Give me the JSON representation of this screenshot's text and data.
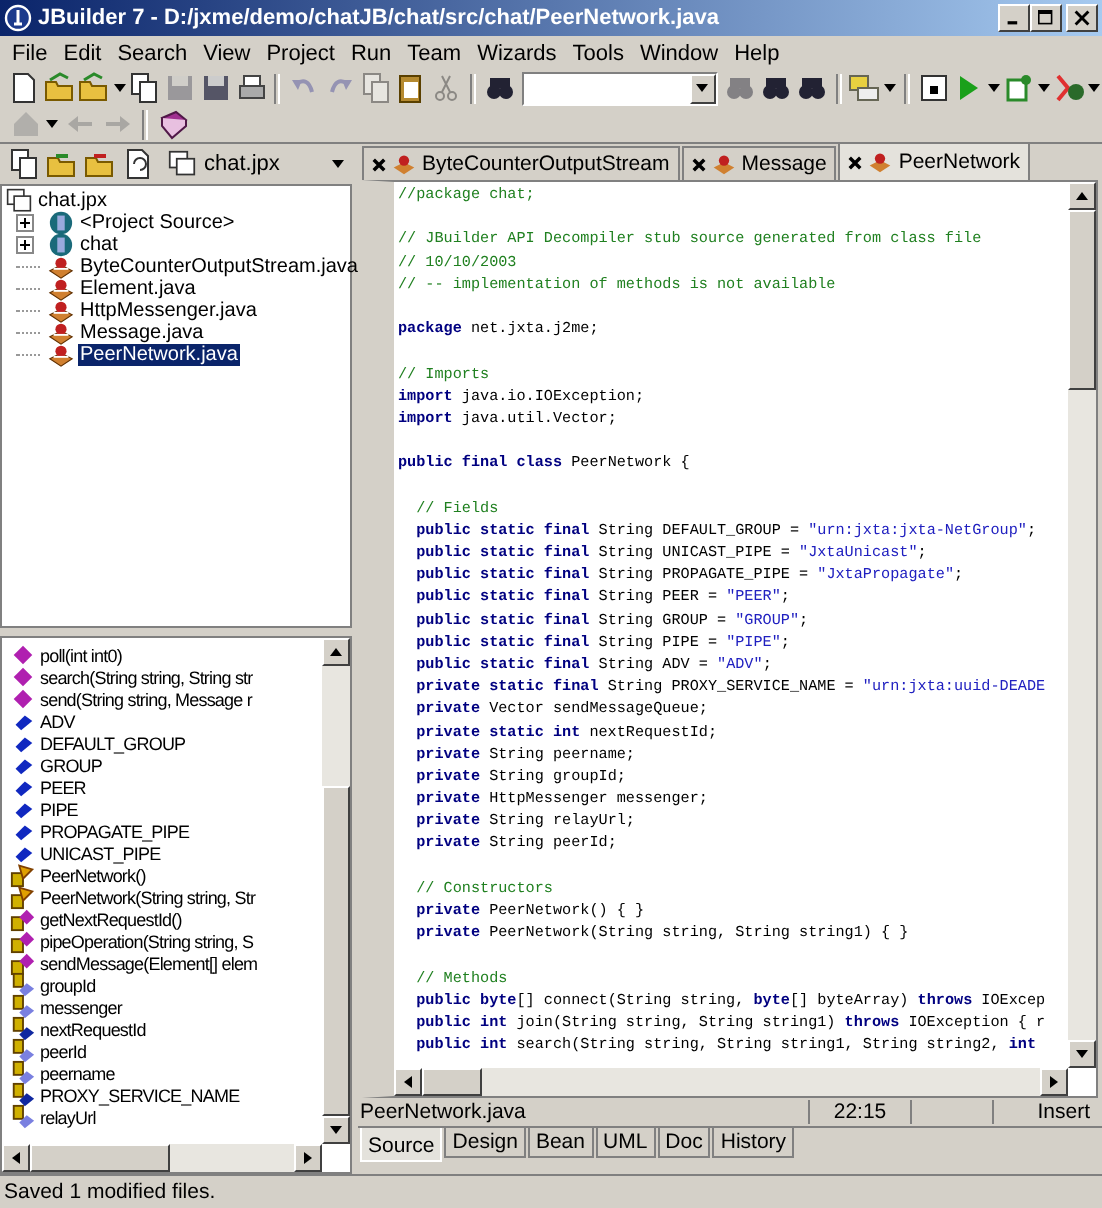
{
  "window": {
    "title": "JBuilder 7 - D:/jxme/demo/chatJB/chat/src/chat/PeerNetwork.java"
  },
  "menu": [
    "File",
    "Edit",
    "Search",
    "View",
    "Project",
    "Run",
    "Team",
    "Wizards",
    "Tools",
    "Window",
    "Help"
  ],
  "project_selector": {
    "value": "chat.jpx"
  },
  "project_tree": {
    "label": "chat.jpx",
    "children": [
      {
        "label": "<Project Source>",
        "kind": "package",
        "expanded": false,
        "selected": false
      },
      {
        "label": "chat",
        "kind": "package",
        "expanded": false,
        "selected": false
      },
      {
        "label": "ByteCounterOutputStream.java",
        "kind": "file",
        "selected": false
      },
      {
        "label": "Element.java",
        "kind": "file",
        "selected": false
      },
      {
        "label": "HttpMessenger.java",
        "kind": "file",
        "selected": false
      },
      {
        "label": "Message.java",
        "kind": "file",
        "selected": false
      },
      {
        "label": "PeerNetwork.java",
        "kind": "file",
        "selected": true
      }
    ]
  },
  "structure": [
    {
      "label": "poll(int int0)",
      "kind": "method"
    },
    {
      "label": "search(String string, String str",
      "kind": "method"
    },
    {
      "label": "send(String string, Message r",
      "kind": "method"
    },
    {
      "label": "ADV",
      "kind": "const"
    },
    {
      "label": "DEFAULT_GROUP",
      "kind": "const"
    },
    {
      "label": "GROUP",
      "kind": "const"
    },
    {
      "label": "PEER",
      "kind": "const"
    },
    {
      "label": "PIPE",
      "kind": "const"
    },
    {
      "label": "PROPAGATE_PIPE",
      "kind": "const"
    },
    {
      "label": "UNICAST_PIPE",
      "kind": "const"
    },
    {
      "label": "PeerNetwork()",
      "kind": "ctor"
    },
    {
      "label": "PeerNetwork(String string, Str",
      "kind": "ctor"
    },
    {
      "label": "getNextRequestId()",
      "kind": "private-method"
    },
    {
      "label": "pipeOperation(String string, S",
      "kind": "private-method"
    },
    {
      "label": "sendMessage(Element[] elem",
      "kind": "private-method"
    },
    {
      "label": "groupId",
      "kind": "private-field"
    },
    {
      "label": "messenger",
      "kind": "private-field"
    },
    {
      "label": "nextRequestId",
      "kind": "private-static"
    },
    {
      "label": "peerId",
      "kind": "private-field"
    },
    {
      "label": "peername",
      "kind": "private-field"
    },
    {
      "label": "PROXY_SERVICE_NAME",
      "kind": "private-static"
    },
    {
      "label": "relayUrl",
      "kind": "private-field"
    }
  ],
  "editor_tabs": [
    {
      "label": "ByteCounterOutputStream",
      "selected": false
    },
    {
      "label": "Message",
      "selected": false
    },
    {
      "label": "PeerNetwork",
      "selected": true
    }
  ],
  "code": [
    {
      "kind": "code",
      "tokens": [
        {
          "kind": "comment",
          "text": "//package chat;"
        }
      ]
    },
    {
      "kind": "blank"
    },
    {
      "kind": "code",
      "tokens": [
        {
          "kind": "comment",
          "text": "// JBuilder API Decompiler stub source generated from class file"
        }
      ]
    },
    {
      "kind": "code",
      "tokens": [
        {
          "kind": "comment",
          "text": "// 10/10/2003"
        }
      ]
    },
    {
      "kind": "code",
      "tokens": [
        {
          "kind": "comment",
          "text": "// -- implementation of methods is not available"
        }
      ]
    },
    {
      "kind": "blank"
    },
    {
      "kind": "code",
      "tokens": [
        {
          "kind": "keyword",
          "text": "package"
        },
        {
          "kind": "plain",
          "text": " net.jxta.j2me;"
        }
      ]
    },
    {
      "kind": "blank"
    },
    {
      "kind": "code",
      "tokens": [
        {
          "kind": "comment",
          "text": "// Imports"
        }
      ]
    },
    {
      "kind": "code",
      "tokens": [
        {
          "kind": "keyword",
          "text": "import"
        },
        {
          "kind": "plain",
          "text": " java.io.IOException;"
        }
      ]
    },
    {
      "kind": "code",
      "tokens": [
        {
          "kind": "keyword",
          "text": "import"
        },
        {
          "kind": "plain",
          "text": " java.util.Vector;"
        }
      ]
    },
    {
      "kind": "blank"
    },
    {
      "kind": "code",
      "tokens": [
        {
          "kind": "keyword",
          "text": "public final class"
        },
        {
          "kind": "plain",
          "text": " PeerNetwork {"
        }
      ]
    },
    {
      "kind": "blank"
    },
    {
      "kind": "code",
      "tokens": [
        {
          "kind": "comment",
          "text": "  // Fields"
        }
      ]
    },
    {
      "kind": "code",
      "tokens": [
        {
          "kind": "keyword",
          "text": "  public static final"
        },
        {
          "kind": "plain",
          "text": " String DEFAULT_GROUP = "
        },
        {
          "kind": "string",
          "text": "\"urn:jxta:jxta-NetGroup\""
        },
        {
          "kind": "plain",
          "text": ";"
        }
      ]
    },
    {
      "kind": "code",
      "tokens": [
        {
          "kind": "keyword",
          "text": "  public static final"
        },
        {
          "kind": "plain",
          "text": " String UNICAST_PIPE = "
        },
        {
          "kind": "string",
          "text": "\"JxtaUnicast\""
        },
        {
          "kind": "plain",
          "text": ";"
        }
      ]
    },
    {
      "kind": "code",
      "tokens": [
        {
          "kind": "keyword",
          "text": "  public static final"
        },
        {
          "kind": "plain",
          "text": " String PROPAGATE_PIPE = "
        },
        {
          "kind": "string",
          "text": "\"JxtaPropagate\""
        },
        {
          "kind": "plain",
          "text": ";"
        }
      ]
    },
    {
      "kind": "code",
      "tokens": [
        {
          "kind": "keyword",
          "text": "  public static final"
        },
        {
          "kind": "plain",
          "text": " String PEER = "
        },
        {
          "kind": "string",
          "text": "\"PEER\""
        },
        {
          "kind": "plain",
          "text": ";"
        }
      ]
    },
    {
      "kind": "code",
      "tokens": [
        {
          "kind": "keyword",
          "text": "  public static final"
        },
        {
          "kind": "plain",
          "text": " String GROUP = "
        },
        {
          "kind": "string",
          "text": "\"GROUP\""
        },
        {
          "kind": "plain",
          "text": ";"
        }
      ]
    },
    {
      "kind": "code",
      "tokens": [
        {
          "kind": "keyword",
          "text": "  public static final"
        },
        {
          "kind": "plain",
          "text": " String PIPE = "
        },
        {
          "kind": "string",
          "text": "\"PIPE\""
        },
        {
          "kind": "plain",
          "text": ";"
        }
      ]
    },
    {
      "kind": "code",
      "tokens": [
        {
          "kind": "keyword",
          "text": "  public static final"
        },
        {
          "kind": "plain",
          "text": " String ADV = "
        },
        {
          "kind": "string",
          "text": "\"ADV\""
        },
        {
          "kind": "plain",
          "text": ";"
        }
      ]
    },
    {
      "kind": "code",
      "tokens": [
        {
          "kind": "keyword",
          "text": "  private static final"
        },
        {
          "kind": "plain",
          "text": " String PROXY_SERVICE_NAME = "
        },
        {
          "kind": "string",
          "text": "\"urn:jxta:uuid-DEADE"
        }
      ]
    },
    {
      "kind": "code",
      "tokens": [
        {
          "kind": "keyword",
          "text": "  private"
        },
        {
          "kind": "plain",
          "text": " Vector sendMessageQueue;"
        }
      ]
    },
    {
      "kind": "code",
      "tokens": [
        {
          "kind": "keyword",
          "text": "  private static int"
        },
        {
          "kind": "plain",
          "text": " nextRequestId;"
        }
      ]
    },
    {
      "kind": "code",
      "tokens": [
        {
          "kind": "keyword",
          "text": "  private"
        },
        {
          "kind": "plain",
          "text": " String peername;"
        }
      ]
    },
    {
      "kind": "code",
      "tokens": [
        {
          "kind": "keyword",
          "text": "  private"
        },
        {
          "kind": "plain",
          "text": " String groupId;"
        }
      ]
    },
    {
      "kind": "code",
      "tokens": [
        {
          "kind": "keyword",
          "text": "  private"
        },
        {
          "kind": "plain",
          "text": " HttpMessenger messenger;"
        }
      ]
    },
    {
      "kind": "code",
      "tokens": [
        {
          "kind": "keyword",
          "text": "  private"
        },
        {
          "kind": "plain",
          "text": " String relayUrl;"
        }
      ]
    },
    {
      "kind": "code",
      "tokens": [
        {
          "kind": "keyword",
          "text": "  private"
        },
        {
          "kind": "plain",
          "text": " String peerId;"
        }
      ]
    },
    {
      "kind": "blank"
    },
    {
      "kind": "code",
      "tokens": [
        {
          "kind": "comment",
          "text": "  // Constructors"
        }
      ]
    },
    {
      "kind": "code",
      "tokens": [
        {
          "kind": "keyword",
          "text": "  private"
        },
        {
          "kind": "plain",
          "text": " PeerNetwork() { }"
        }
      ]
    },
    {
      "kind": "code",
      "tokens": [
        {
          "kind": "keyword",
          "text": "  private"
        },
        {
          "kind": "plain",
          "text": " PeerNetwork(String string, String string1) { }"
        }
      ]
    },
    {
      "kind": "blank"
    },
    {
      "kind": "code",
      "tokens": [
        {
          "kind": "comment",
          "text": "  // Methods"
        }
      ]
    },
    {
      "kind": "code",
      "tokens": [
        {
          "kind": "keyword",
          "text": "  public byte"
        },
        {
          "kind": "plain",
          "text": "[] connect(String string, "
        },
        {
          "kind": "keyword",
          "text": "byte"
        },
        {
          "kind": "plain",
          "text": "[] byteArray) "
        },
        {
          "kind": "keyword",
          "text": "throws"
        },
        {
          "kind": "plain",
          "text": " IOExcep"
        }
      ]
    },
    {
      "kind": "code",
      "tokens": [
        {
          "kind": "keyword",
          "text": "  public int"
        },
        {
          "kind": "plain",
          "text": " join(String string, String string1) "
        },
        {
          "kind": "keyword",
          "text": "throws"
        },
        {
          "kind": "plain",
          "text": " IOException { r"
        }
      ]
    },
    {
      "kind": "code",
      "tokens": [
        {
          "kind": "keyword",
          "text": "  public int"
        },
        {
          "kind": "plain",
          "text": " search(String string, String string1, String string2, "
        },
        {
          "kind": "keyword",
          "text": "int"
        }
      ]
    }
  ],
  "editor_status": {
    "file": "PeerNetwork.java",
    "position": "22:15",
    "mode": "Insert"
  },
  "view_tabs": [
    {
      "label": "Source",
      "selected": true
    },
    {
      "label": "Design",
      "selected": false
    },
    {
      "label": "Bean",
      "selected": false
    },
    {
      "label": "UML",
      "selected": false
    },
    {
      "label": "Doc",
      "selected": false
    },
    {
      "label": "History",
      "selected": false
    }
  ],
  "status_bar": "Saved 1 modified files."
}
